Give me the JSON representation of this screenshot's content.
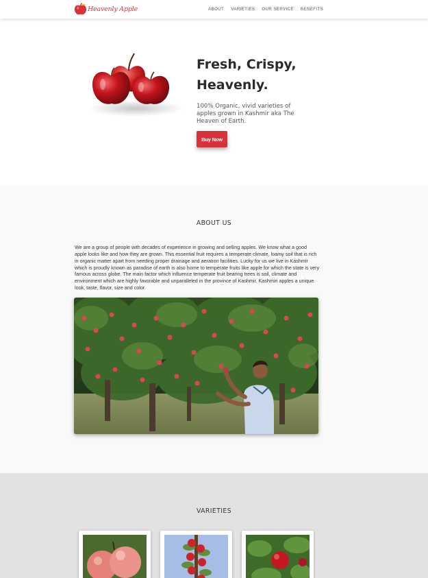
{
  "navbar": {
    "logo_text": "Heavenly Apple",
    "links": [
      "ABOUT",
      "VARIETIES",
      "OUR SERVICE",
      "BENEFITS"
    ]
  },
  "hero": {
    "title_line1": "Fresh, Crispy,",
    "title_line2": "Heavenly.",
    "description": "100% Organic, vivid varieties of apples grown in Kashmir aka The Heaven of Earth.",
    "button_label": "Buy Now",
    "image_icon": "apples-image"
  },
  "about": {
    "title": "ABOUT US",
    "text": "We are a group of people with decades of experience in growing and selling apples. We know what a good apple looks like and how they are grown. This essential fruit requires a temperate climate, loamy soil that is rich in organic matter apart from needing proper drainage and aeration facilities. Lucky for us we live in Kashmir which is proudly known as paradise of earth is also home to temperate fruits like apple for which the state is very famous across globe. The main factor which influence temperate fruit bearing trees is soil, climate and environment which are highly favorable and unparalleled in the province of Kashmir. Kashmiri apples a unique look, taste, flavor, size and color.",
    "photo_icon": "orchard-photo"
  },
  "varieties": {
    "title": "VARIETIES",
    "cards": [
      {
        "icon": "pink-apples-image"
      },
      {
        "icon": "apple-branch-image"
      },
      {
        "icon": "red-apple-tree-image"
      }
    ]
  },
  "colors": {
    "brand_red": "#d8323a",
    "about_bg": "#f9f9f9",
    "varieties_bg": "#e2e2e2"
  }
}
